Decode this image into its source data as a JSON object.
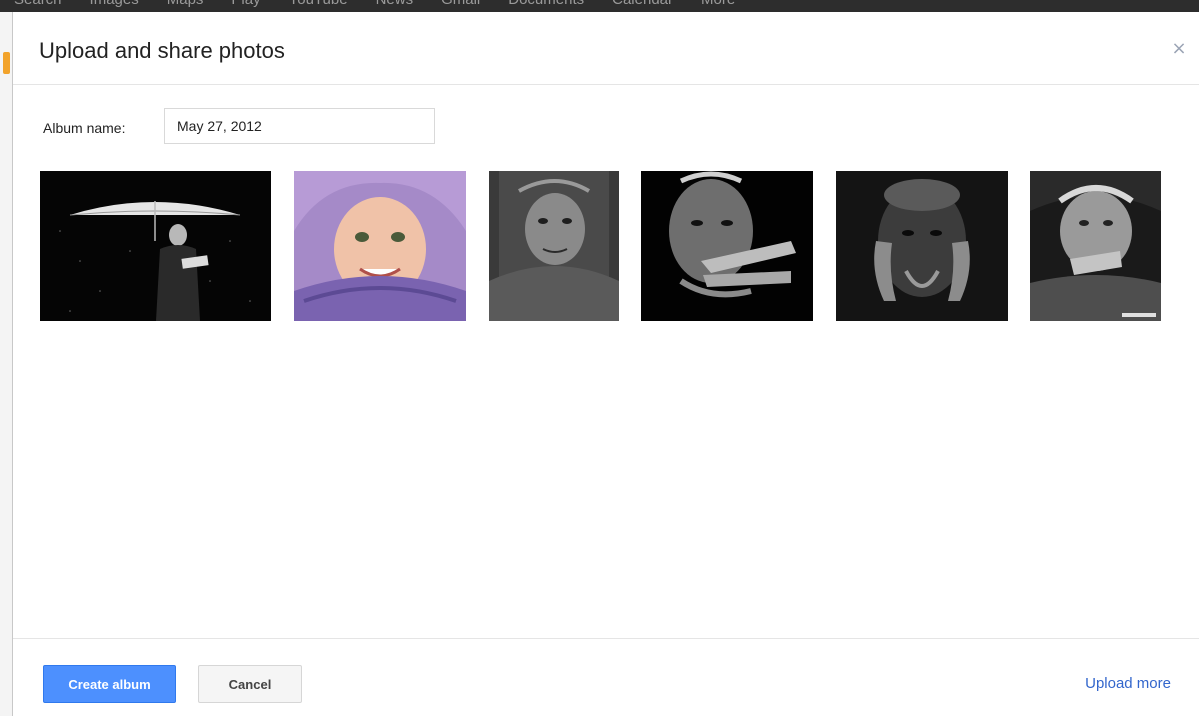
{
  "background_nav": {
    "items": [
      "Search",
      "Images",
      "Maps",
      "Play",
      "YouTube",
      "News",
      "Gmail",
      "Documents",
      "Calendar",
      "More"
    ]
  },
  "dialog": {
    "title": "Upload and share photos",
    "close_icon": "close-icon",
    "close_symbol": "×"
  },
  "album": {
    "label": "Album name:",
    "value": "May 27, 2012"
  },
  "photos": [
    {
      "name": "photo-umbrella-reader",
      "description_icon": "photo-thumbnail"
    },
    {
      "name": "photo-girl-scarf",
      "description_icon": "photo-thumbnail"
    },
    {
      "name": "photo-old-woman-bw",
      "description_icon": "photo-thumbnail"
    },
    {
      "name": "photo-man-hand-bw",
      "description_icon": "photo-thumbnail"
    },
    {
      "name": "photo-man-hands-face-bw",
      "description_icon": "photo-thumbnail"
    },
    {
      "name": "photo-old-woman-smoking-bw",
      "description_icon": "photo-thumbnail"
    }
  ],
  "footer": {
    "create_label": "Create album",
    "cancel_label": "Cancel",
    "upload_more_label": "Upload more"
  },
  "colors": {
    "primary_button": "#4d90fe",
    "link": "#3366cc",
    "close_icon": "#9aa3b4"
  }
}
